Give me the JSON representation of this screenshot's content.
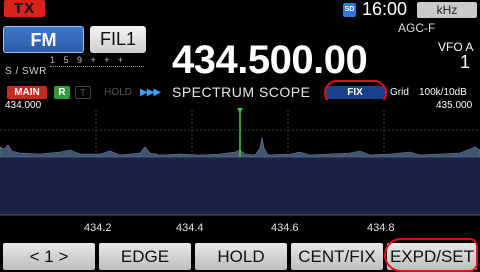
{
  "top": {
    "tx_label": "TX",
    "sd_label": "SD",
    "clock": "16:00",
    "unit_button": "kHz",
    "agc": "AGC-F"
  },
  "mode": {
    "mode_button": "FM",
    "filter_button": "FIL1"
  },
  "meter": {
    "label": "S / SWR",
    "scale": "1 5 9 + + +"
  },
  "frequency": "434.500.00",
  "vfo": {
    "label": "VFO A",
    "number": "1"
  },
  "scope_bar": {
    "main": "MAIN",
    "r": "R",
    "t": "T",
    "hold": "HOLD",
    "arrows": "▶▶▶",
    "title": "SPECTRUM SCOPE",
    "fix": "FIX",
    "grid": "Grid",
    "span": "100k/10dB"
  },
  "scope": {
    "edge_low": "434.000",
    "edge_high": "435.000",
    "ticks": [
      "434.2",
      "434.4",
      "434.6",
      "434.8"
    ],
    "center_marker_color": "#33cc33",
    "background_color": "#1a2346"
  },
  "buttons": {
    "page": "< 1 >",
    "edge": "EDGE",
    "hold": "HOLD",
    "cent_fix": "CENT/FIX",
    "expd_set": "EXPD/SET"
  },
  "colors": {
    "tx": "#d8231c",
    "main_tag": "#c62a23",
    "r_tag": "#2f9d3d",
    "fix_tag": "#1b3f8f",
    "annotation": "#e41010"
  }
}
